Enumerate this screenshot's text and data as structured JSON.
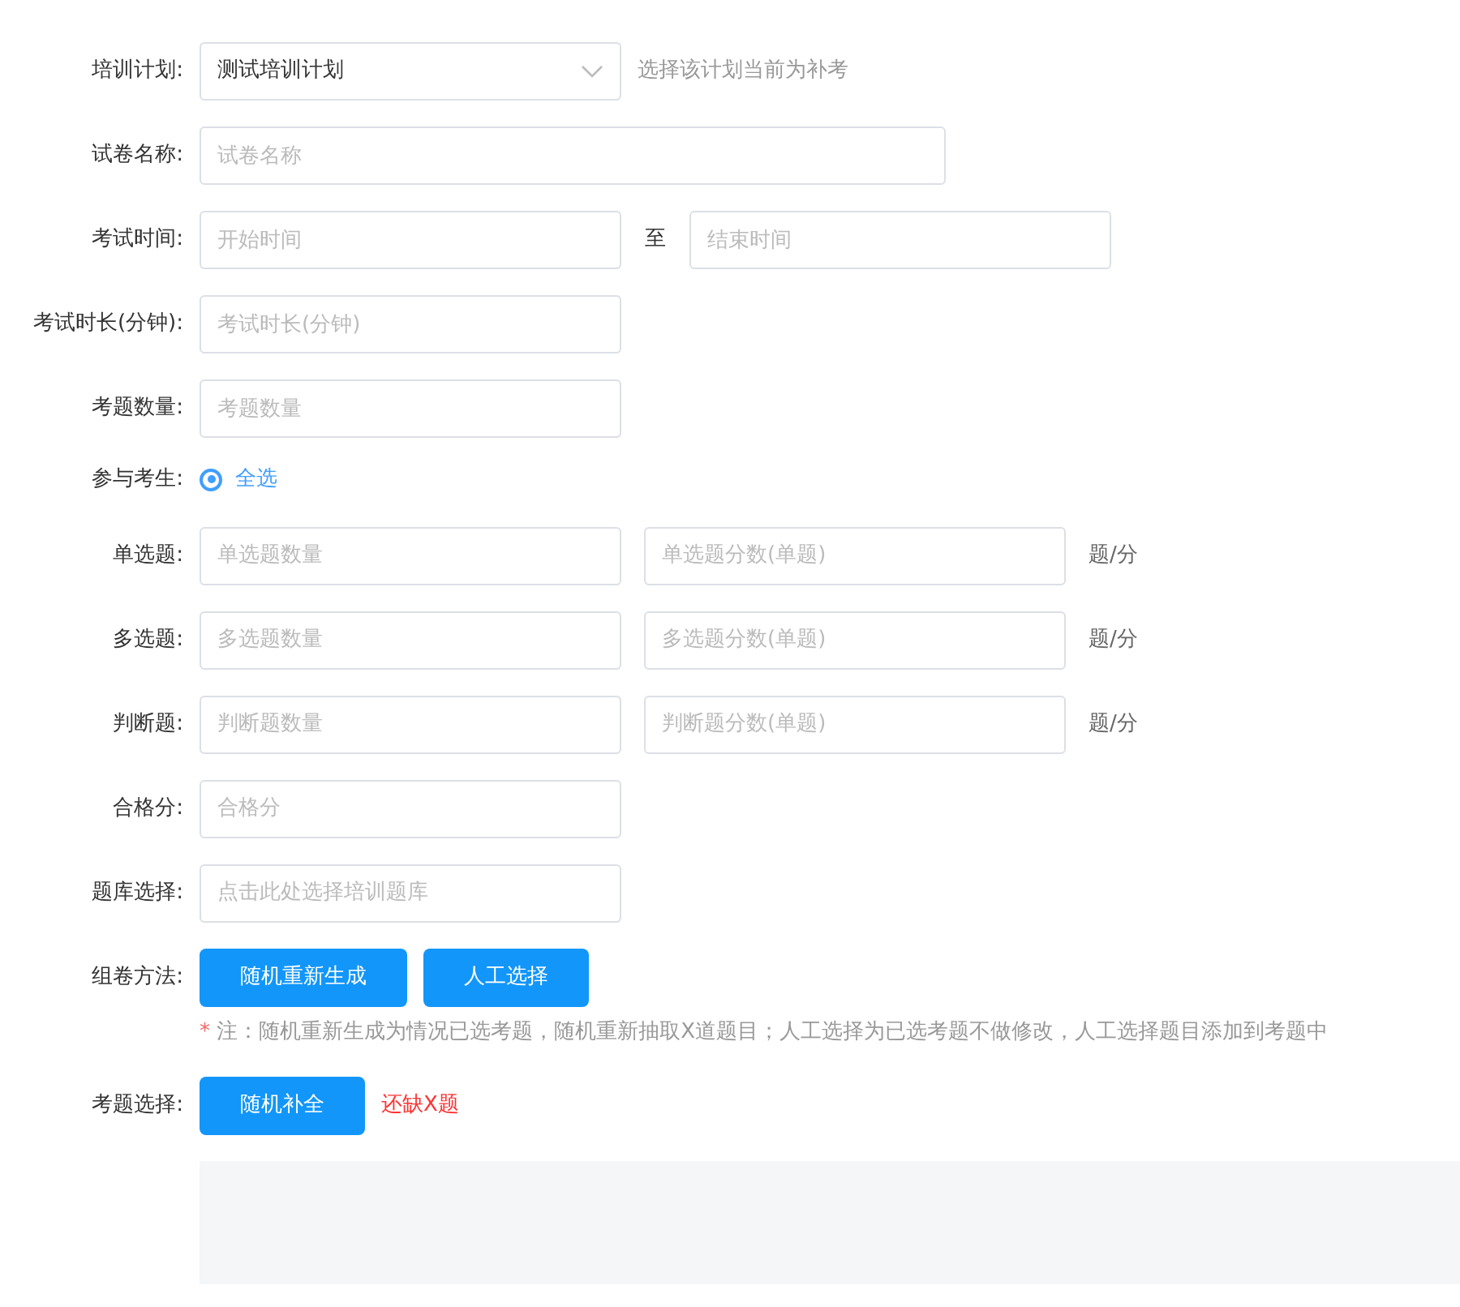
{
  "rows": [
    {
      "kind": "select",
      "label": "培训计划:",
      "value": "测试培训计划",
      "hint": "选择该计划当前为补考"
    },
    {
      "kind": "long-input",
      "label": "试卷名称:",
      "placeholder": "试卷名称"
    },
    {
      "kind": "range",
      "label": "考试时间:",
      "start_placeholder": "开始时间",
      "separator": "至",
      "end_placeholder": "结束时间"
    },
    {
      "kind": "input",
      "label": "考试时长(分钟):",
      "placeholder": "考试时长(分钟)"
    },
    {
      "kind": "input",
      "label": "考题数量:",
      "placeholder": "考题数量"
    },
    {
      "kind": "radio",
      "label": "参与考生:",
      "options": [
        {
          "label": "全选",
          "selected": true
        }
      ]
    },
    {
      "kind": "pair",
      "label": "单选题:",
      "count_placeholder": "单选题数量",
      "score_placeholder": "单选题分数(单题)",
      "unit": "题/分"
    },
    {
      "kind": "pair",
      "label": "多选题:",
      "count_placeholder": "多选题数量",
      "score_placeholder": "多选题分数(单题)",
      "unit": "题/分"
    },
    {
      "kind": "pair",
      "label": "判断题:",
      "count_placeholder": "判断题数量",
      "score_placeholder": "判断题分数(单题)",
      "unit": "题/分"
    },
    {
      "kind": "input",
      "label": "合格分:",
      "placeholder": "合格分"
    },
    {
      "kind": "input",
      "label": "题库选择:",
      "placeholder": "点击此处选择培训题库"
    },
    {
      "kind": "buttons",
      "label": "组卷方法:",
      "buttons": [
        "随机重新生成",
        "人工选择"
      ],
      "note_mark": "*",
      "note": "注：随机重新生成为情况已选考题，随机重新抽取X道题目；人工选择为已选考题不做修改，人工选择题目添加到考题中"
    },
    {
      "kind": "buttons",
      "label": "考题选择:",
      "buttons": [
        "随机补全"
      ],
      "warning": "还缺X题"
    }
  ]
}
